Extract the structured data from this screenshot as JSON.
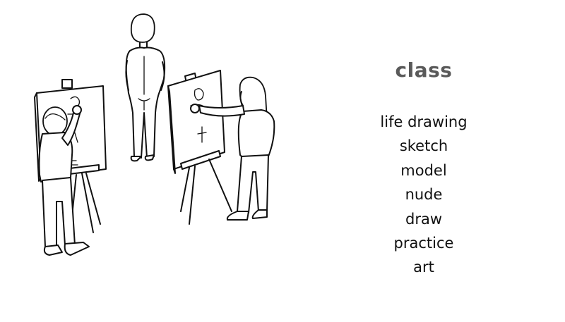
{
  "title": "class",
  "words": [
    "life drawing",
    "sketch",
    "model",
    "nude",
    "draw",
    "practice",
    "art"
  ],
  "colors": {
    "title": "#5a5a5a",
    "text": "#111111",
    "background": "#ffffff"
  }
}
